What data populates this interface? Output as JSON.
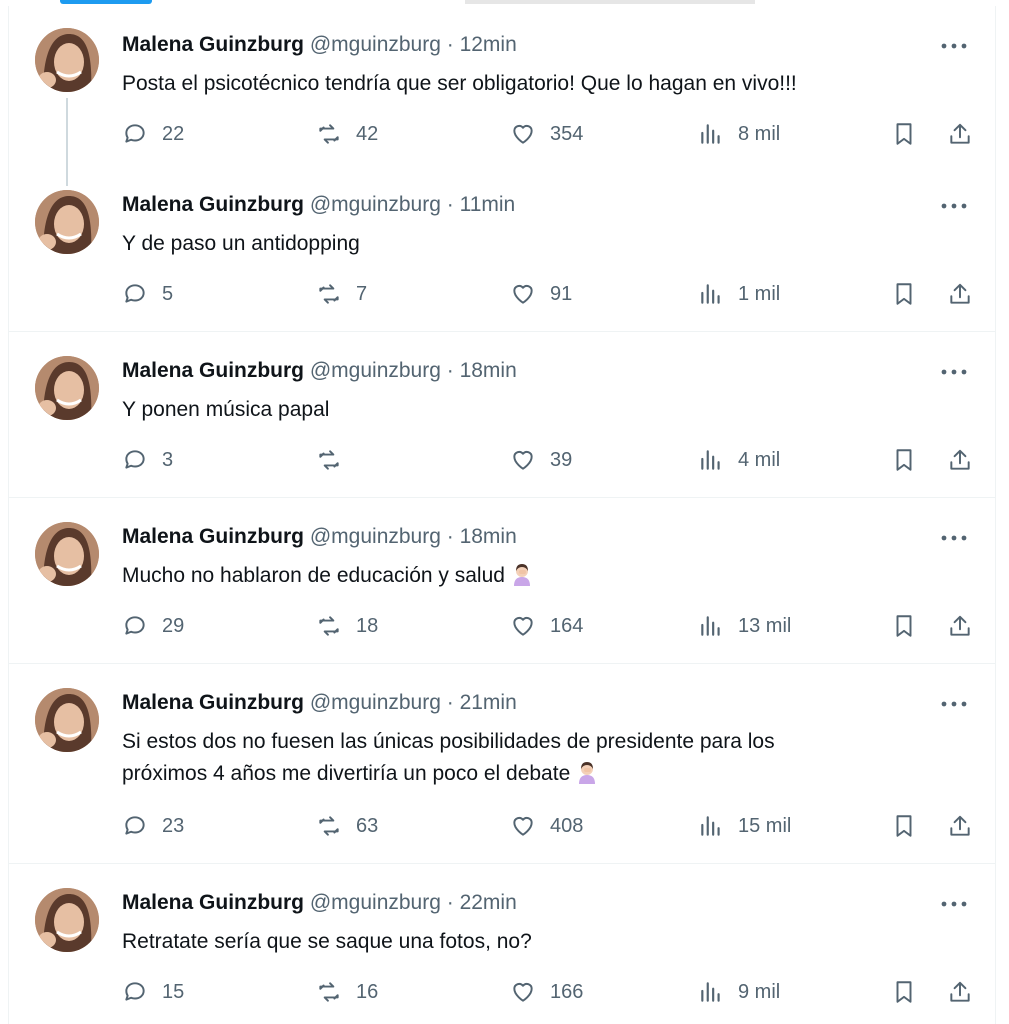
{
  "tweets": [
    {
      "name": "Malena Guinzburg",
      "handle": "@mguinzburg",
      "time": "12min",
      "text": "Posta el psicotécnico tendría que ser obligatorio! Que lo hagan en vivo!!!",
      "replies": "22",
      "reposts": "42",
      "likes": "354",
      "views": "8 mil"
    },
    {
      "name": "Malena Guinzburg",
      "handle": "@mguinzburg",
      "time": "11min",
      "text": "Y de paso un antidopping",
      "replies": "5",
      "reposts": "7",
      "likes": "91",
      "views": "1 mil"
    },
    {
      "name": "Malena Guinzburg",
      "handle": "@mguinzburg",
      "time": "18min",
      "text": "Y ponen música papal",
      "replies": "3",
      "reposts": "",
      "likes": "39",
      "views": "4 mil"
    },
    {
      "name": "Malena Guinzburg",
      "handle": "@mguinzburg",
      "time": "18min",
      "text": "Mucho no hablaron de educación y salud",
      "emoji": "person-facepalming",
      "replies": "29",
      "reposts": "18",
      "likes": "164",
      "views": "13 mil"
    },
    {
      "name": "Malena Guinzburg",
      "handle": "@mguinzburg",
      "time": "21min",
      "text_line1": "Si estos dos no fuesen las únicas posibilidades de presidente para los",
      "text_line2": "próximos 4 años me divertiría un poco el debate",
      "emoji": "person-facepalming",
      "replies": "23",
      "reposts": "63",
      "likes": "408",
      "views": "15 mil"
    },
    {
      "name": "Malena Guinzburg",
      "handle": "@mguinzburg",
      "time": "22min",
      "text": "Retratate sería que se saque una fotos, no?",
      "replies": "15",
      "reposts": "16",
      "likes": "166",
      "views": "9 mil"
    }
  ],
  "sep": " · ",
  "icons": {
    "reply": "reply-bubble-icon",
    "repost": "repost-icon",
    "like": "heart-icon",
    "views": "views-bars-icon",
    "bookmark": "bookmark-icon",
    "share": "share-icon",
    "more": "more-dots-icon"
  },
  "colors": {
    "text": "#0f1419",
    "muted": "#536471",
    "border": "#eff3f4",
    "thread": "#cfd9de"
  }
}
